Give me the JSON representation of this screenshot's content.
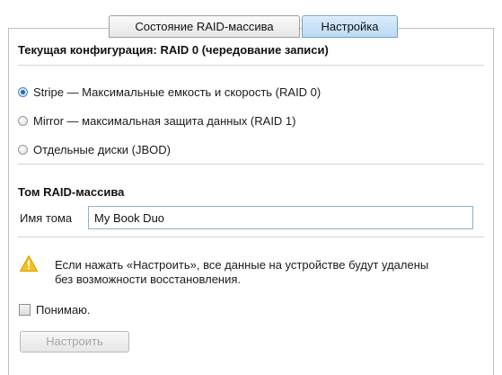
{
  "tabs": [
    {
      "label": "Состояние RAID-массива",
      "active": false
    },
    {
      "label": "Настройка",
      "active": true
    }
  ],
  "config": {
    "current_label": "Текущая конфигурация:",
    "current_value": "RAID 0 (чередование записи)"
  },
  "raid_options": [
    {
      "label": "Stripe — Максимальные емкость и скорость (RAID 0)",
      "selected": true
    },
    {
      "label": "Mirror — максимальная защита данных (RAID 1)",
      "selected": false
    },
    {
      "label": "Отдельные диски (JBOD)",
      "selected": false
    }
  ],
  "volume": {
    "section_title": "Том RAID-массива",
    "name_label": "Имя тома",
    "name_value": "My Book Duo"
  },
  "warning": {
    "icon": "warning-triangle-icon",
    "text": "Если нажать «Настроить», все данные на устройстве будут удалены без возможности восстановления."
  },
  "acknowledge": {
    "label": "Понимаю.",
    "checked": false
  },
  "configure_button": {
    "label": "Настроить",
    "enabled": false
  },
  "colors": {
    "active_tab": "#bcdaf3",
    "radio_selected": "#2a63a8",
    "warning": "#f5b800"
  }
}
